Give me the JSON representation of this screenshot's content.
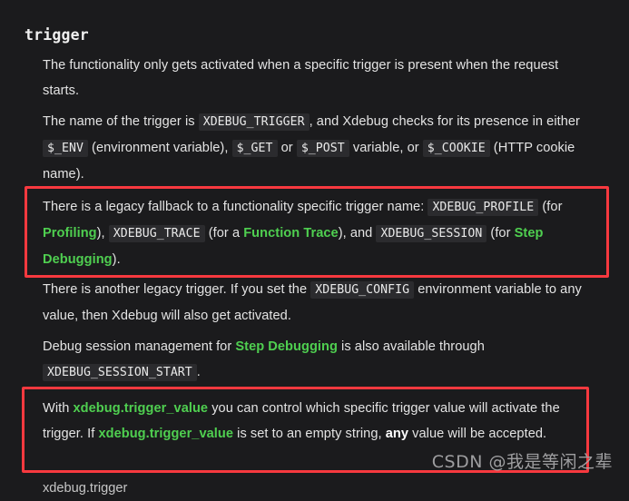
{
  "page": {
    "background_color": "#1b1b1d",
    "text_color": "#e3e3e3",
    "accent_green": "#4fcf50",
    "annotation_red": "#f7393f",
    "code_background": "#2b2b2e"
  },
  "heading": {
    "text": "trigger"
  },
  "paragraphs": {
    "intro": {
      "t1": "The functionality only gets activated when a specific trigger is present when the request starts."
    },
    "trigger_name": {
      "t1": "The name of the trigger is ",
      "code1": "XDEBUG_TRIGGER",
      "t2": ", and Xdebug checks for its presence in either ",
      "code2": "$_ENV",
      "t3": " (environment variable), ",
      "code3": "$_GET",
      "t4": " or ",
      "code4": "$_POST",
      "t5": " variable, or ",
      "code5": "$_COOKIE",
      "t6": " (HTTP cookie name)."
    },
    "legacy_fallback": {
      "t1": "There is a legacy fallback to a functionality specific trigger name: ",
      "code1": "XDEBUG_PROFILE",
      "t2": " (for ",
      "link1": "Profiling",
      "t3": "), ",
      "code2": "XDEBUG_TRACE",
      "t4": " (for a ",
      "link2": "Function Trace",
      "t5": "), and ",
      "code3": "XDEBUG_SESSION",
      "t6": " (for ",
      "link3": "Step Debugging",
      "t7": ")."
    },
    "legacy_config": {
      "t1": "There is another legacy trigger. If you set the ",
      "code1": "XDEBUG_CONFIG",
      "t2": " environment variable to any value, then Xdebug will also get activated."
    },
    "session_mgmt": {
      "t1": "Debug session management for ",
      "link1": "Step Debugging",
      "t2": " is also available through ",
      "code1": "XDEBUG_SESSION_START",
      "t3": "."
    },
    "trigger_value": {
      "t1": "With ",
      "link1": "xdebug.trigger_value",
      "t2": " you can control which specific trigger value will activate the trigger. If ",
      "link2": "xdebug.trigger_value",
      "t3": " is set to an empty string, ",
      "bold1": "any",
      "t4": " value will be accepted."
    },
    "bottom_clipped": {
      "t1": "xdebug.trigger"
    }
  },
  "annotations": {
    "box_legacy_fallback_label": "red-highlight-box",
    "box_trigger_value_label": "red-highlight-box"
  },
  "watermark": {
    "text": "CSDN @我是等闲之辈"
  }
}
